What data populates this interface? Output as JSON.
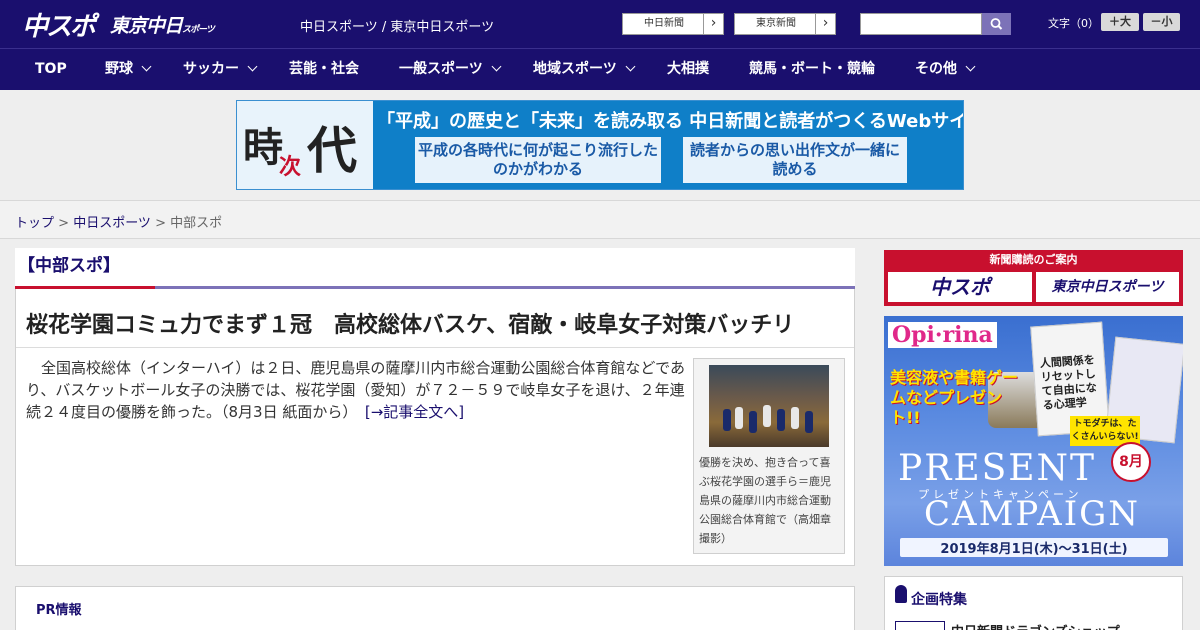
{
  "header": {
    "logo_chuspo": "中スポ",
    "logo_tokyo": "東京中日",
    "logo_tokyo_sub": "スポーツ",
    "site_title": "中日スポーツ / 東京中日スポーツ",
    "news_buttons": [
      "中日新聞",
      "東京新聞"
    ],
    "search": {
      "value": "",
      "placeholder": ""
    },
    "font_size": {
      "label": "文字（0）",
      "increase": "＋大",
      "decrease": "－小"
    }
  },
  "nav": {
    "items": [
      {
        "label": "TOP"
      },
      {
        "label": "野球"
      },
      {
        "label": "サッカー"
      },
      {
        "label": "芸能・社会"
      },
      {
        "label": "一般スポーツ"
      },
      {
        "label": "地域スポーツ"
      },
      {
        "label": "大相撲"
      },
      {
        "label": "競馬・ボート・競輪"
      },
      {
        "label": "その他"
      }
    ]
  },
  "banner": {
    "kanji_ji": "時",
    "kanji_tsugi": "次",
    "kanji_dai": "代",
    "headline": "「平成」の歴史と「未来」を読み取る 中日新聞と読者がつくるWebサイト",
    "box1": "平成の各時代に何が起こり流行したのかがわかる",
    "box2": "読者からの思い出作文が一緒に読める"
  },
  "breadcrumb": {
    "home": "トップ",
    "section": "中日スポーツ",
    "current": "中部スポ",
    "sep": " > "
  },
  "category": {
    "title": "【中部スポ】"
  },
  "article": {
    "title": "桜花学園コミュ力でまず１冠　高校総体バスケ、宿敵・岐阜女子対策バッチリ",
    "body": "　全国高校総体（インターハイ）は２日、鹿児島県の薩摩川内市総合運動公園総合体育館などであり、バスケットボール女子の決勝では、桜花学園（愛知）が７２－５９で岐阜女子を退け、２年連続２４度目の優勝を飾った。（8月3日 紙面から）　",
    "more": "[→記事全文へ]",
    "caption": "優勝を決め、抱き合って喜ぶ桜花学園の選手ら＝鹿児島県の薩摩川内市総合運動公園総合体育館で（高畑章撮影）"
  },
  "pr": {
    "title": "PR情報"
  },
  "sidebar": {
    "subscribe": {
      "head": "新聞購読のご案内",
      "logo1": "中スポ",
      "logo2": "東京中日スポーツ"
    },
    "ad": {
      "brand": "Opi·rina",
      "promo": "美容液や書籍ゲームなどプレゼント!!",
      "book_title": "人間関係をリセットして自由になる心理学",
      "book_badge": "トモダチは、たくさんいらない!",
      "present": "PRESENT",
      "present_sub": "プレゼントキャンペーン",
      "campaign": "CAMPAIGN",
      "month": "8月",
      "dates": "2019年8月1日(木)〜31日(土)"
    },
    "feature": {
      "title": "企画特集",
      "item": "中日新聞ドラゴンズショップ"
    }
  },
  "colors": {
    "navy": "#1a0f6e",
    "accent_red": "#c8102e",
    "accent_purple": "#7c72b8"
  }
}
